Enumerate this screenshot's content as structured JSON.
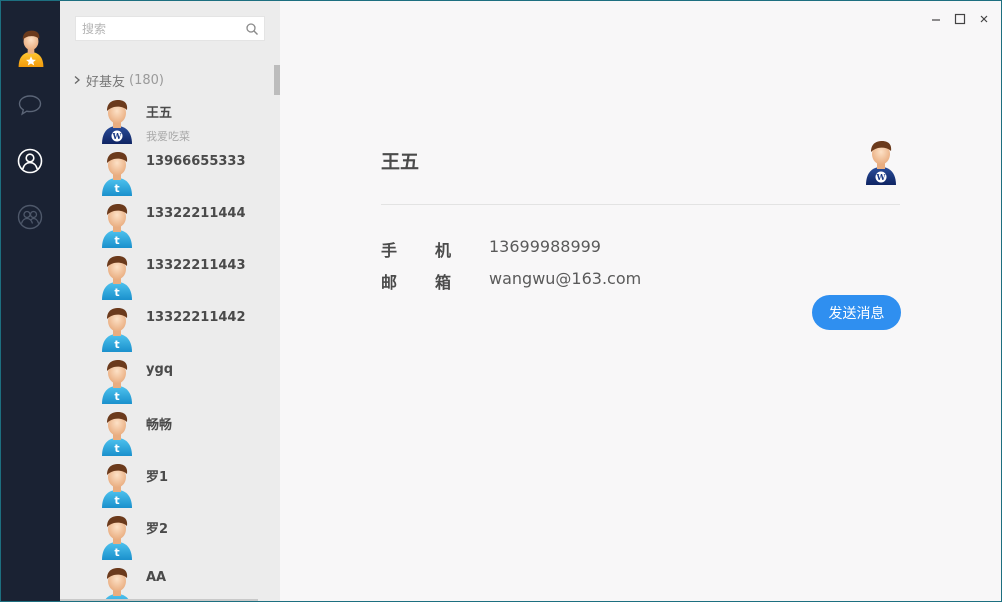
{
  "search": {
    "placeholder": "搜索"
  },
  "group": {
    "name": "好基友",
    "count": "(180)"
  },
  "contacts": [
    {
      "name": "王五",
      "status": "我爱吃菜",
      "avatar": "wordpress-user-icon"
    },
    {
      "name": "13966655333",
      "status": "",
      "avatar": "twitter-user-icon"
    },
    {
      "name": "13322211444",
      "status": "",
      "avatar": "twitter-user-icon"
    },
    {
      "name": "13322211443",
      "status": "",
      "avatar": "twitter-user-icon"
    },
    {
      "name": "13322211442",
      "status": "",
      "avatar": "twitter-user-icon"
    },
    {
      "name": "ygq",
      "status": "",
      "avatar": "twitter-user-icon"
    },
    {
      "name": "畅畅",
      "status": "",
      "avatar": "twitter-user-icon"
    },
    {
      "name": "罗1",
      "status": "",
      "avatar": "twitter-user-icon"
    },
    {
      "name": "罗2",
      "status": "",
      "avatar": "twitter-user-icon"
    },
    {
      "name": "AA",
      "status": "",
      "avatar": "twitter-user-icon"
    }
  ],
  "detail": {
    "name": "王五",
    "phone_label": [
      "手",
      "机"
    ],
    "phone": "13699988999",
    "email_label": [
      "邮",
      "箱"
    ],
    "email": "wangwu@163.com",
    "send_label": "发送消息"
  },
  "colors": {
    "rail": "#1a2233",
    "list_bg": "#ececec",
    "main_bg": "#f8f7f8",
    "accent": "#2f8ff0"
  }
}
